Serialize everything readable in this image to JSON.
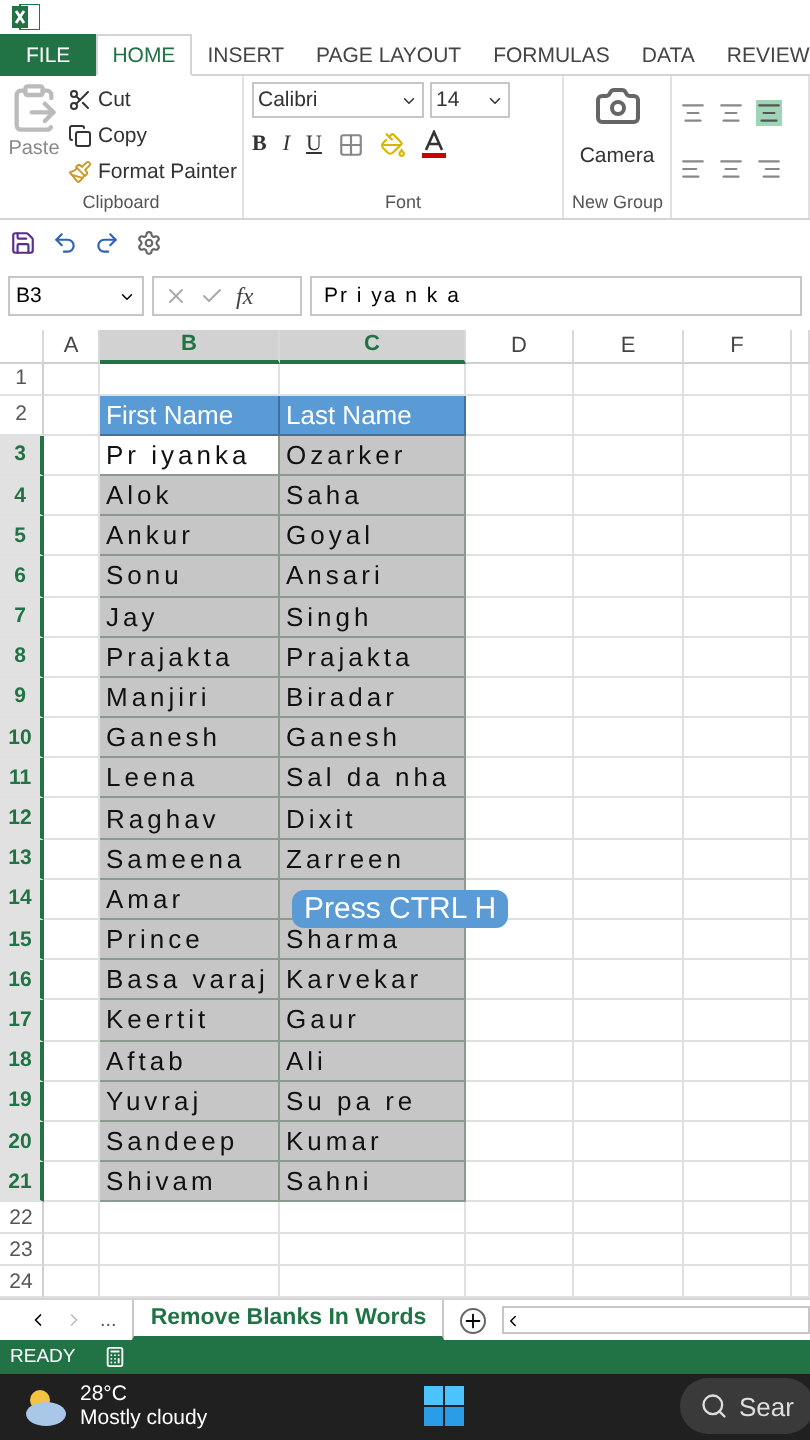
{
  "ribbon_tabs": [
    {
      "label": "FILE",
      "kind": "file",
      "selected": false
    },
    {
      "label": "HOME",
      "kind": "tab",
      "selected": true
    },
    {
      "label": "INSERT",
      "kind": "tab",
      "selected": false
    },
    {
      "label": "PAGE LAYOUT",
      "kind": "tab",
      "selected": false
    },
    {
      "label": "FORMULAS",
      "kind": "tab",
      "selected": false
    },
    {
      "label": "DATA",
      "kind": "tab",
      "selected": false
    },
    {
      "label": "REVIEW",
      "kind": "tab",
      "selected": false
    }
  ],
  "clipboard": {
    "paste": "Paste",
    "cut": "Cut",
    "copy": "Copy",
    "format_painter": "Format Painter",
    "label": "Clipboard"
  },
  "font": {
    "name": "Calibri",
    "size": "14",
    "bold": "B",
    "italic": "I",
    "underline": "U",
    "label": "Font"
  },
  "new_group": {
    "camera": "Camera",
    "label": "New Group"
  },
  "formula_bar": {
    "name_box": "B3",
    "fx": "fx",
    "value": "Pr i ya n k a"
  },
  "columns": [
    {
      "label": "A",
      "selected": false
    },
    {
      "label": "B",
      "selected": true
    },
    {
      "label": "C",
      "selected": true
    },
    {
      "label": "D",
      "selected": false
    },
    {
      "label": "E",
      "selected": false
    },
    {
      "label": "F",
      "selected": false
    }
  ],
  "rows": [
    {
      "number": "1",
      "kind": "empty",
      "selected": false
    },
    {
      "number": "2",
      "kind": "header",
      "selected": false,
      "first": "First Name",
      "last": "Last Name"
    },
    {
      "number": "3",
      "kind": "data",
      "selected": true,
      "active": true,
      "first": "Pr iyanka",
      "last": "Ozarker"
    },
    {
      "number": "4",
      "kind": "data",
      "selected": true,
      "active": false,
      "first": "Alok",
      "last": "Saha"
    },
    {
      "number": "5",
      "kind": "data",
      "selected": true,
      "active": false,
      "first": "Ankur",
      "last": "Goyal"
    },
    {
      "number": "6",
      "kind": "data",
      "selected": true,
      "active": false,
      "first": "Sonu",
      "last": "Ansari"
    },
    {
      "number": "7",
      "kind": "data",
      "selected": true,
      "active": false,
      "first": "Jay",
      "last": "Singh"
    },
    {
      "number": "8",
      "kind": "data",
      "selected": true,
      "active": false,
      "first": "Prajakta",
      "last": "Prajakta"
    },
    {
      "number": "9",
      "kind": "data",
      "selected": true,
      "active": false,
      "first": "Manjiri",
      "last": "Biradar"
    },
    {
      "number": "10",
      "kind": "data",
      "selected": true,
      "active": false,
      "first": "Ganesh",
      "last": "Ganesh"
    },
    {
      "number": "11",
      "kind": "data",
      "selected": true,
      "active": false,
      "first": "Leena",
      "last": "Sal da nha"
    },
    {
      "number": "12",
      "kind": "data",
      "selected": true,
      "active": false,
      "first": "Raghav",
      "last": "Dixit"
    },
    {
      "number": "13",
      "kind": "data",
      "selected": true,
      "active": false,
      "first": "Sameena",
      "last": "Zarreen"
    },
    {
      "number": "14",
      "kind": "data",
      "selected": true,
      "active": false,
      "first": "Amar"
    },
    {
      "number": "15",
      "kind": "data",
      "selected": true,
      "active": false,
      "first": "Prince",
      "last": "Sharma"
    },
    {
      "number": "16",
      "kind": "data",
      "selected": true,
      "active": false,
      "first": "Basa varaj",
      "last": "Karvekar"
    },
    {
      "number": "17",
      "kind": "data",
      "selected": true,
      "active": false,
      "first": "Keertit",
      "last": "Gaur"
    },
    {
      "number": "18",
      "kind": "data",
      "selected": true,
      "active": false,
      "first": "Aftab",
      "last": "Ali"
    },
    {
      "number": "19",
      "kind": "data",
      "selected": true,
      "active": false,
      "first": "Yuvraj",
      "last": "Su pa re"
    },
    {
      "number": "20",
      "kind": "data",
      "selected": true,
      "active": false,
      "first": "Sandeep",
      "last": "Kumar"
    },
    {
      "number": "21",
      "kind": "data",
      "selected": true,
      "active": false,
      "first": "Shivam",
      "last": "Sahni"
    },
    {
      "number": "22",
      "kind": "empty",
      "selected": false
    },
    {
      "number": "23",
      "kind": "empty",
      "selected": false
    },
    {
      "number": "24",
      "kind": "empty",
      "selected": false
    }
  ],
  "callout": "Press CTRL H",
  "sheet_tabs": {
    "more": "...",
    "tabs": [
      {
        "label": "Remove Blanks In Words",
        "selected": true
      }
    ]
  },
  "status_bar": {
    "text": "READY"
  },
  "taskbar": {
    "temperature": "28°C",
    "weather": "Mostly cloudy",
    "search": "Sear"
  }
}
